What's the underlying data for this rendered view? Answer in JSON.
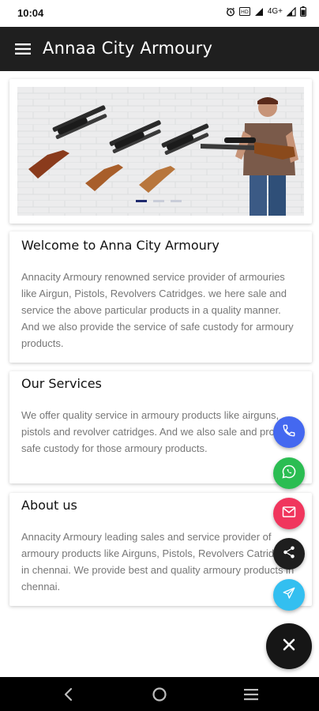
{
  "status_bar": {
    "time": "10:04",
    "network": "4G+",
    "icons": [
      "alarm-icon",
      "volte-icon",
      "signal-icon",
      "network-4g-icon",
      "signal-icon"
    ]
  },
  "app_bar": {
    "title": "Annaa City Armoury",
    "menu_icon": "hamburger-menu-icon"
  },
  "banner": {
    "slides": 3,
    "active_slide": 1
  },
  "cards": {
    "welcome": {
      "heading": "Welcome to Anna City Armoury",
      "body": "Annacity Armoury renowned service provider of armouries like Airgun, Pistols, Revolvers Catridges. we here sale and service the above particular products in a quality manner. And we also provide the service of safe custody for armoury products."
    },
    "services": {
      "heading": "Our Services",
      "body": "We offer quality service in armoury products like airguns, pistols and revolver catridges. And we also sale and provide safe custody for those armoury products."
    },
    "about": {
      "heading": "About us",
      "body": "Annacity Armoury leading sales and service provider of armoury products  like Airguns, Pistols, Revolvers Catridges in chennai. We provide best and quality armoury products in chennai."
    }
  },
  "fabs": [
    {
      "name": "phone",
      "icon": "phone-icon",
      "color": "#4468f0"
    },
    {
      "name": "whatsapp",
      "icon": "whatsapp-icon",
      "color": "#2bbd52"
    },
    {
      "name": "mail",
      "icon": "mail-icon",
      "color": "#f0365d"
    },
    {
      "name": "share",
      "icon": "share-icon",
      "color": "#1e1e1e"
    },
    {
      "name": "send",
      "icon": "send-icon",
      "color": "#33bff0"
    },
    {
      "name": "close",
      "icon": "close-icon",
      "color": "#161616"
    }
  ],
  "nav_bar": {
    "buttons": [
      "back-icon",
      "home-icon",
      "recents-icon"
    ]
  },
  "colors": {
    "app_bar": "#1f1f1f",
    "indicator_active": "#1f2a6e",
    "indicator_inactive": "#c9cdd8",
    "body_text": "#777777"
  }
}
